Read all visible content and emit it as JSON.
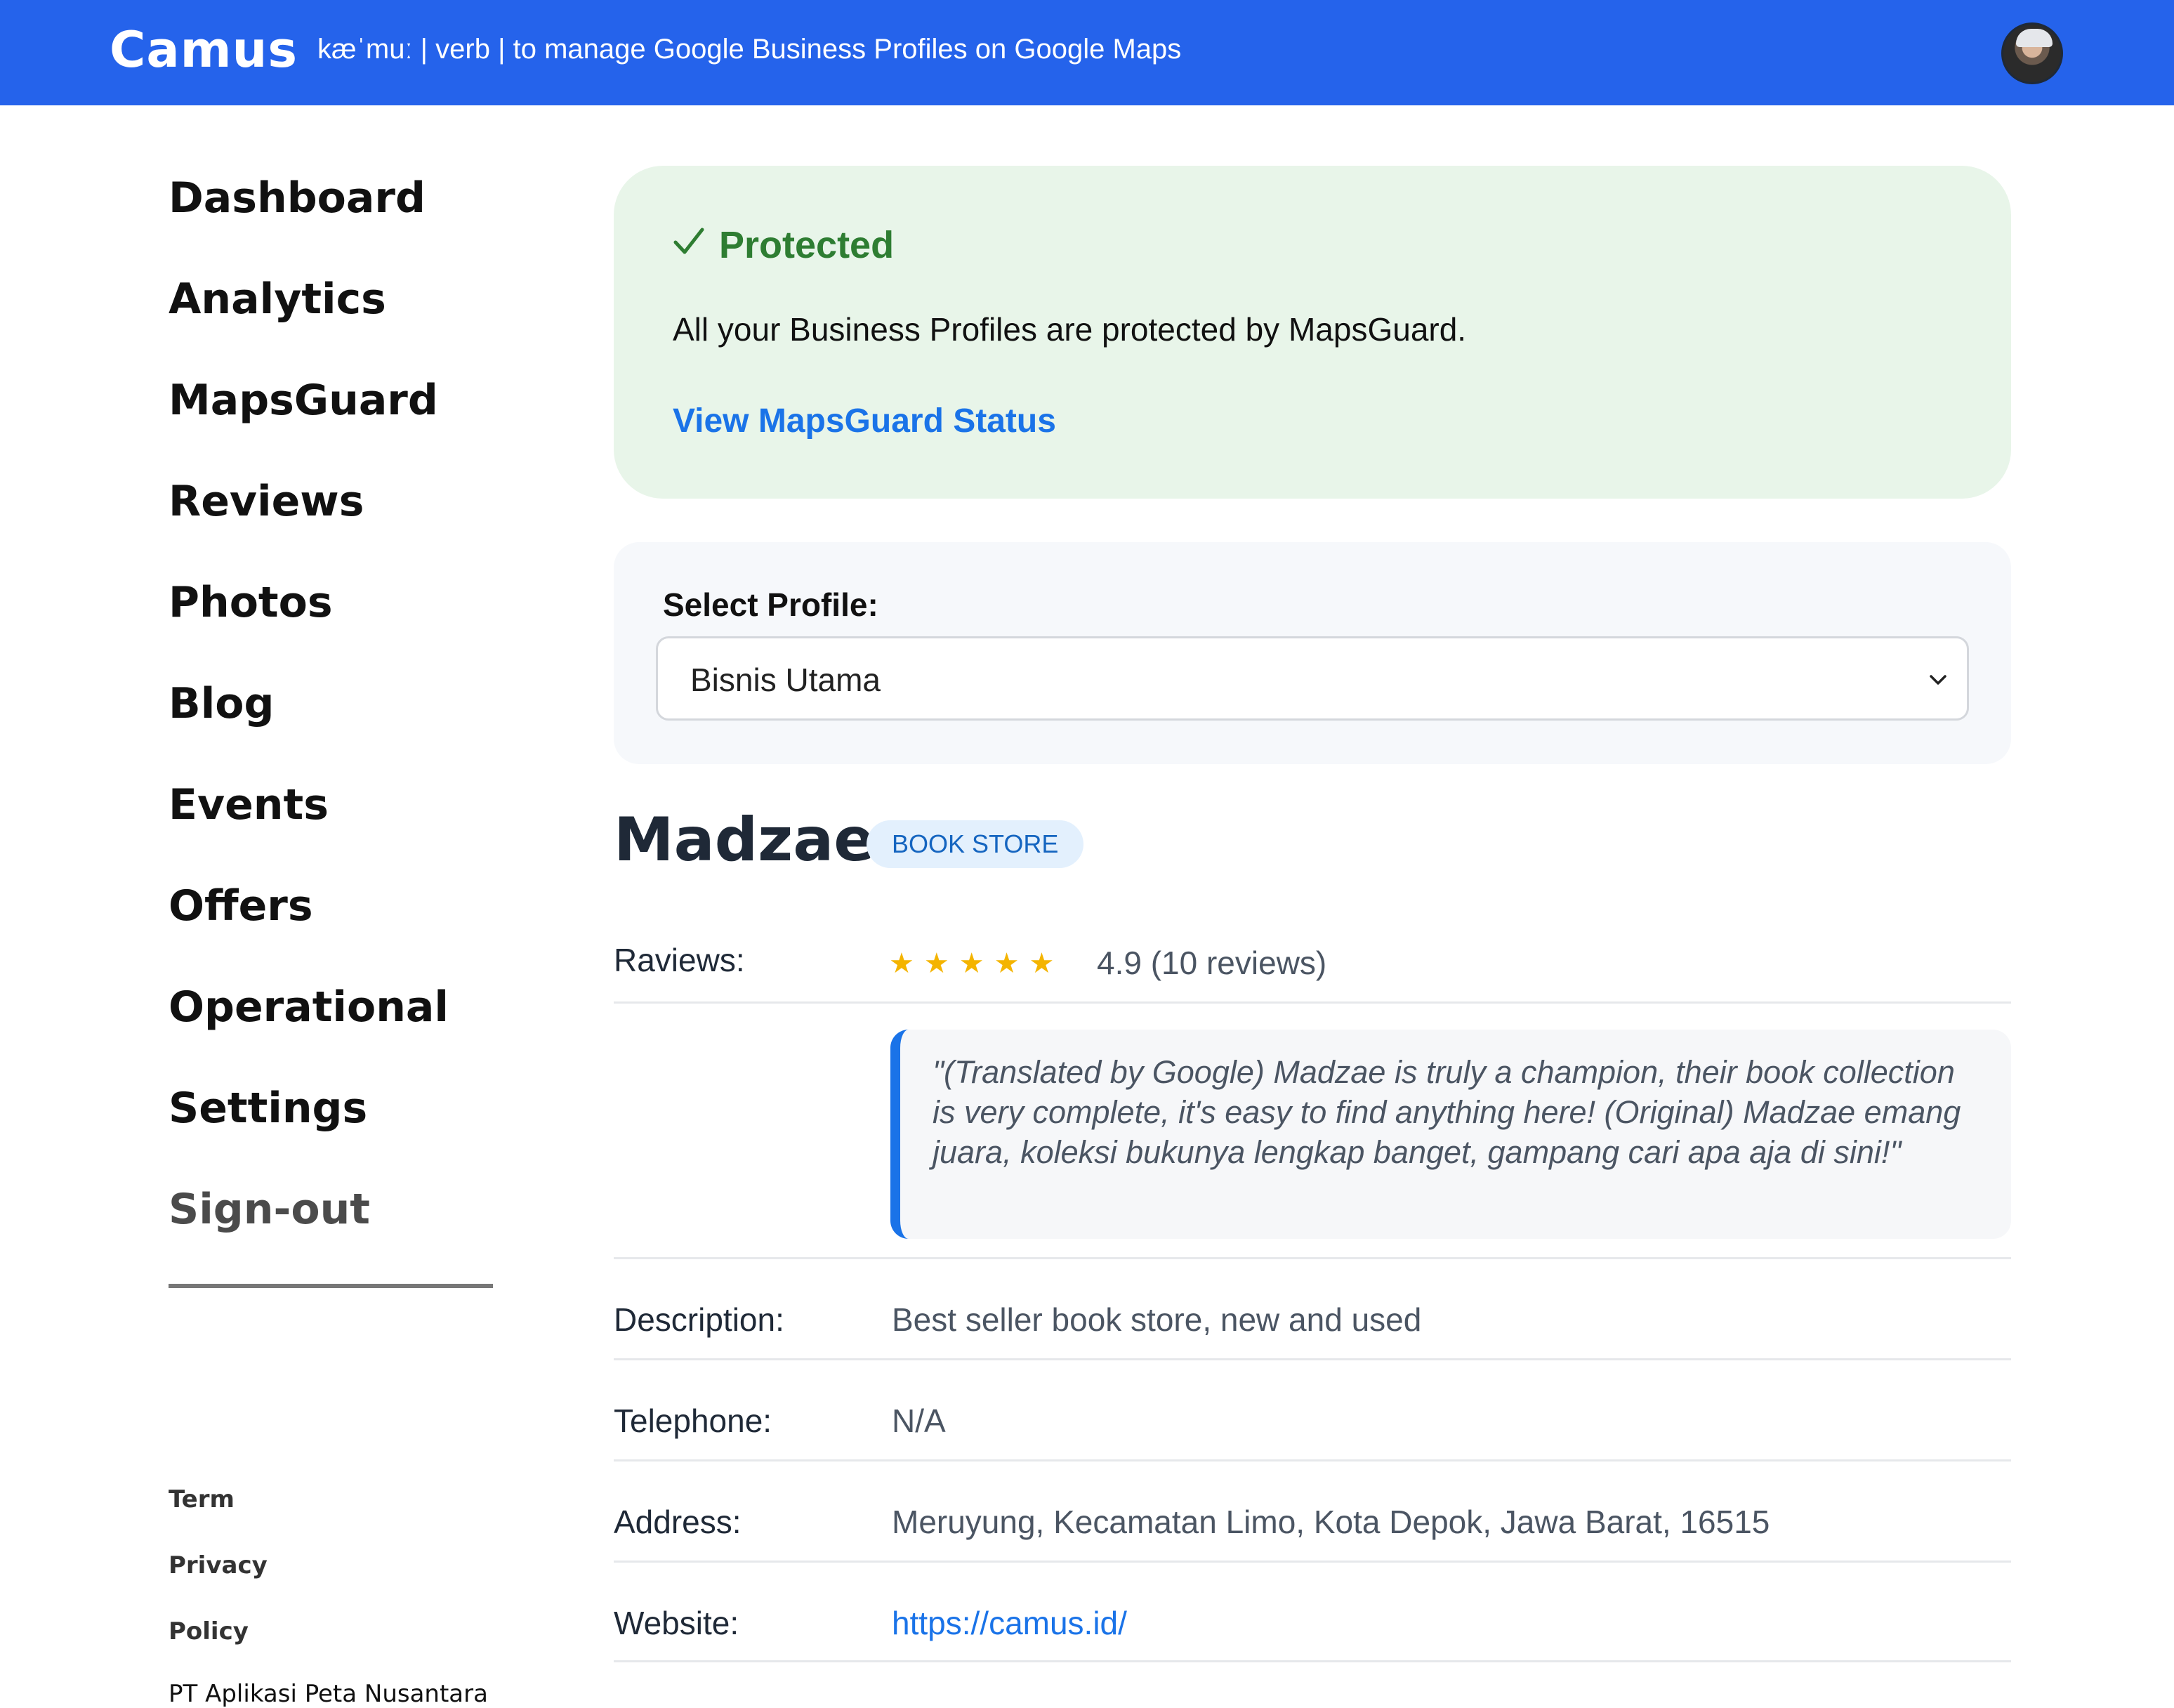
{
  "header": {
    "brand": "Camus",
    "tagline": "kæˈmuː | verb |  to manage Google Business Profiles on Google Maps",
    "avatar_icon": "user-avatar"
  },
  "sidebar": {
    "items": [
      {
        "label": "Dashboard"
      },
      {
        "label": "Analytics"
      },
      {
        "label": "MapsGuard"
      },
      {
        "label": "Reviews"
      },
      {
        "label": "Photos"
      },
      {
        "label": "Blog"
      },
      {
        "label": "Events"
      },
      {
        "label": "Offers"
      },
      {
        "label": "Operational"
      },
      {
        "label": "Settings"
      },
      {
        "label": "Sign-out"
      }
    ],
    "footer_links": [
      {
        "label": "Term"
      },
      {
        "label": "Privacy"
      },
      {
        "label": "Policy"
      }
    ],
    "company": "PT Aplikasi Peta Nusantara"
  },
  "protection": {
    "title": "Protected",
    "icon": "check-icon",
    "message": "All your Business Profiles are protected by MapsGuard.",
    "link": "View MapsGuard Status",
    "color": "#2e7d32",
    "background": "#e8f5e9"
  },
  "profile_select": {
    "label": "Select Profile:",
    "selected": "Bisnis Utama"
  },
  "business": {
    "name": "Madzae",
    "category": "BOOK STORE",
    "reviews_label": "Raviews:",
    "stars": "★★★★★",
    "rating_text": "4.9 (10 reviews)",
    "review_quote": "\"(Translated by Google) Madzae is truly a champion, their book collection is very complete, it's easy to find anything here! (Original) Madzae emang juara, koleksi bukunya lengkap banget, gampang cari apa aja di sini!\"",
    "description_label": "Description:",
    "description": "Best seller book store, new and used",
    "telephone_label": "Telephone:",
    "telephone": "N/A",
    "address_label": "Address:",
    "address": "Meruyung, Kecamatan Limo, Kota Depok, Jawa Barat, 16515",
    "website_label": "Website:",
    "website": "https://camus.id/"
  },
  "colors": {
    "header": "#2563eb",
    "link": "#1a73e8",
    "star": "#f4b400"
  }
}
